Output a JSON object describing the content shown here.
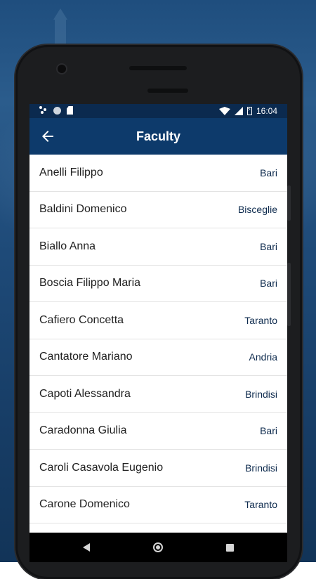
{
  "status_bar": {
    "time": "16:04",
    "icons": [
      "assistant-icon",
      "circle-icon",
      "sd-card-icon",
      "wifi-icon",
      "signal-icon",
      "battery-charging-icon"
    ]
  },
  "app_bar": {
    "title": "Faculty",
    "back_icon": "arrow-left-icon"
  },
  "faculty": [
    {
      "name": "Anelli Filippo",
      "city": "Bari"
    },
    {
      "name": "Baldini Domenico",
      "city": "Bisceglie"
    },
    {
      "name": "Biallo Anna",
      "city": "Bari"
    },
    {
      "name": "Boscia Filippo Maria",
      "city": "Bari"
    },
    {
      "name": "Cafiero Concetta",
      "city": "Taranto"
    },
    {
      "name": "Cantatore Mariano",
      "city": "Andria"
    },
    {
      "name": "Capoti Alessandra",
      "city": "Brindisi"
    },
    {
      "name": "Caradonna Giulia",
      "city": "Bari"
    },
    {
      "name": "Caroli Casavola Eugenio",
      "city": "Brindisi"
    },
    {
      "name": "Carone Domenico",
      "city": "Taranto"
    }
  ],
  "nav_bar": {
    "icons": [
      "back-triangle-icon",
      "home-circle-icon",
      "recents-square-icon"
    ]
  },
  "colors": {
    "app_bar": "#0d3a6b",
    "status_bar": "#0b2a4f",
    "city_text": "#0d2a4d",
    "name_text": "#212121"
  }
}
